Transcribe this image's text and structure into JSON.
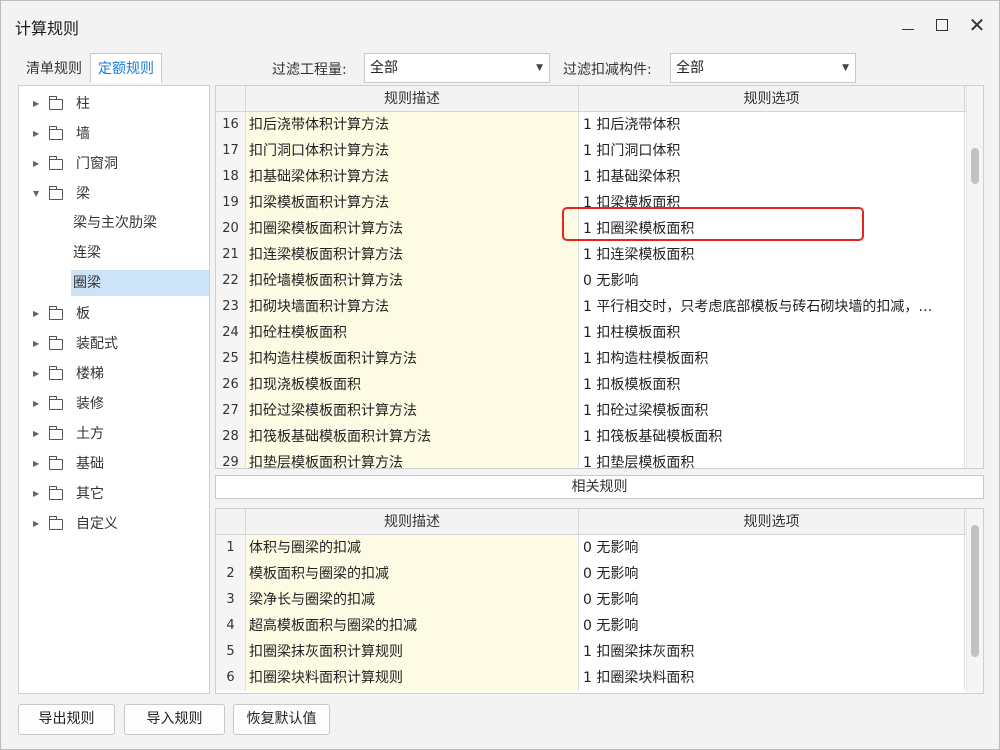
{
  "window": {
    "title": "计算规则",
    "minimize_icon": "minimize-icon",
    "maximize_icon": "maximize-icon",
    "close_icon": "close-icon",
    "close_glyph": "✕"
  },
  "tabs": [
    {
      "label": "清单规则",
      "active": false
    },
    {
      "label": "定额规则",
      "active": true
    }
  ],
  "filters": {
    "quantity_label": "过滤工程量:",
    "quantity_value": "全部",
    "component_label": "过滤扣减构件:",
    "component_value": "全部"
  },
  "tree": {
    "items": [
      {
        "label": "柱",
        "expanded": false
      },
      {
        "label": "墙",
        "expanded": false
      },
      {
        "label": "门窗洞",
        "expanded": false
      },
      {
        "label": "梁",
        "expanded": true
      },
      {
        "label": "板",
        "expanded": false
      },
      {
        "label": "装配式",
        "expanded": false
      },
      {
        "label": "楼梯",
        "expanded": false
      },
      {
        "label": "装修",
        "expanded": false
      },
      {
        "label": "土方",
        "expanded": false
      },
      {
        "label": "基础",
        "expanded": false
      },
      {
        "label": "其它",
        "expanded": false
      },
      {
        "label": "自定义",
        "expanded": false
      }
    ],
    "beam_children": [
      {
        "label": "梁与主次肋梁",
        "selected": false
      },
      {
        "label": "连梁",
        "selected": false
      },
      {
        "label": "圈梁",
        "selected": true
      }
    ]
  },
  "rules_table": {
    "headers": [
      "规则描述",
      "规则选项"
    ],
    "rows": [
      {
        "num": "16",
        "desc": "扣后浇带体积计算方法",
        "option": "1 扣后浇带体积"
      },
      {
        "num": "17",
        "desc": "扣门洞口体积计算方法",
        "option": "1 扣门洞口体积"
      },
      {
        "num": "18",
        "desc": "扣基础梁体积计算方法",
        "option": "1 扣基础梁体积"
      },
      {
        "num": "19",
        "desc": "扣梁模板面积计算方法",
        "option": "1  扣梁模板面积"
      },
      {
        "num": "20",
        "desc": "扣圈梁模板面积计算方法",
        "option": "1  扣圈梁模板面积"
      },
      {
        "num": "21",
        "desc": "扣连梁模板面积计算方法",
        "option": "1 扣连梁模板面积"
      },
      {
        "num": "22",
        "desc": "扣砼墙模板面积计算方法",
        "option": "0  无影响"
      },
      {
        "num": "23",
        "desc": "扣砌块墙面积计算方法",
        "option": "1 平行相交时，只考虑底部模板与砖石砌块墙的扣减，…"
      },
      {
        "num": "24",
        "desc": "扣砼柱模板面积",
        "option": "1 扣柱模板面积"
      },
      {
        "num": "25",
        "desc": "扣构造柱模板面积计算方法",
        "option": "1 扣构造柱模板面积"
      },
      {
        "num": "26",
        "desc": "扣现浇板模板面积",
        "option": "1 扣板模板面积"
      },
      {
        "num": "27",
        "desc": "扣砼过梁模板面积计算方法",
        "option": "1 扣砼过梁模板面积"
      },
      {
        "num": "28",
        "desc": "扣筏板基础模板面积计算方法",
        "option": "1 扣筏板基础模板面积"
      },
      {
        "num": "29",
        "desc": "扣垫层模板面积计算方法",
        "option": "1 扣垫层模板面积"
      }
    ],
    "highlighted_row": "20"
  },
  "related": {
    "title": "相关规则",
    "headers": [
      "规则描述",
      "规则选项"
    ],
    "rows": [
      {
        "num": "1",
        "desc": "体积与圈梁的扣减",
        "option": "0  无影响"
      },
      {
        "num": "2",
        "desc": "模板面积与圈梁的扣减",
        "option": "0  无影响"
      },
      {
        "num": "3",
        "desc": "梁净长与圈梁的扣减",
        "option": "0  无影响"
      },
      {
        "num": "4",
        "desc": "超高模板面积与圈梁的扣减",
        "option": "0  无影响"
      },
      {
        "num": "5",
        "desc": "扣圈梁抹灰面积计算规则",
        "option": "1 扣圈梁抹灰面积"
      },
      {
        "num": "6",
        "desc": "扣圈梁块料面积计算规则",
        "option": "1 扣圈梁块料面积"
      }
    ]
  },
  "buttons": {
    "export": "导出规则",
    "import": "导入规则",
    "restore": "恢复默认值"
  },
  "colors": {
    "accent": "#1a7be0",
    "highlight_border": "#e8241f",
    "desc_bg": "#fdfbe4",
    "selected_bg": "#cde3f7"
  }
}
